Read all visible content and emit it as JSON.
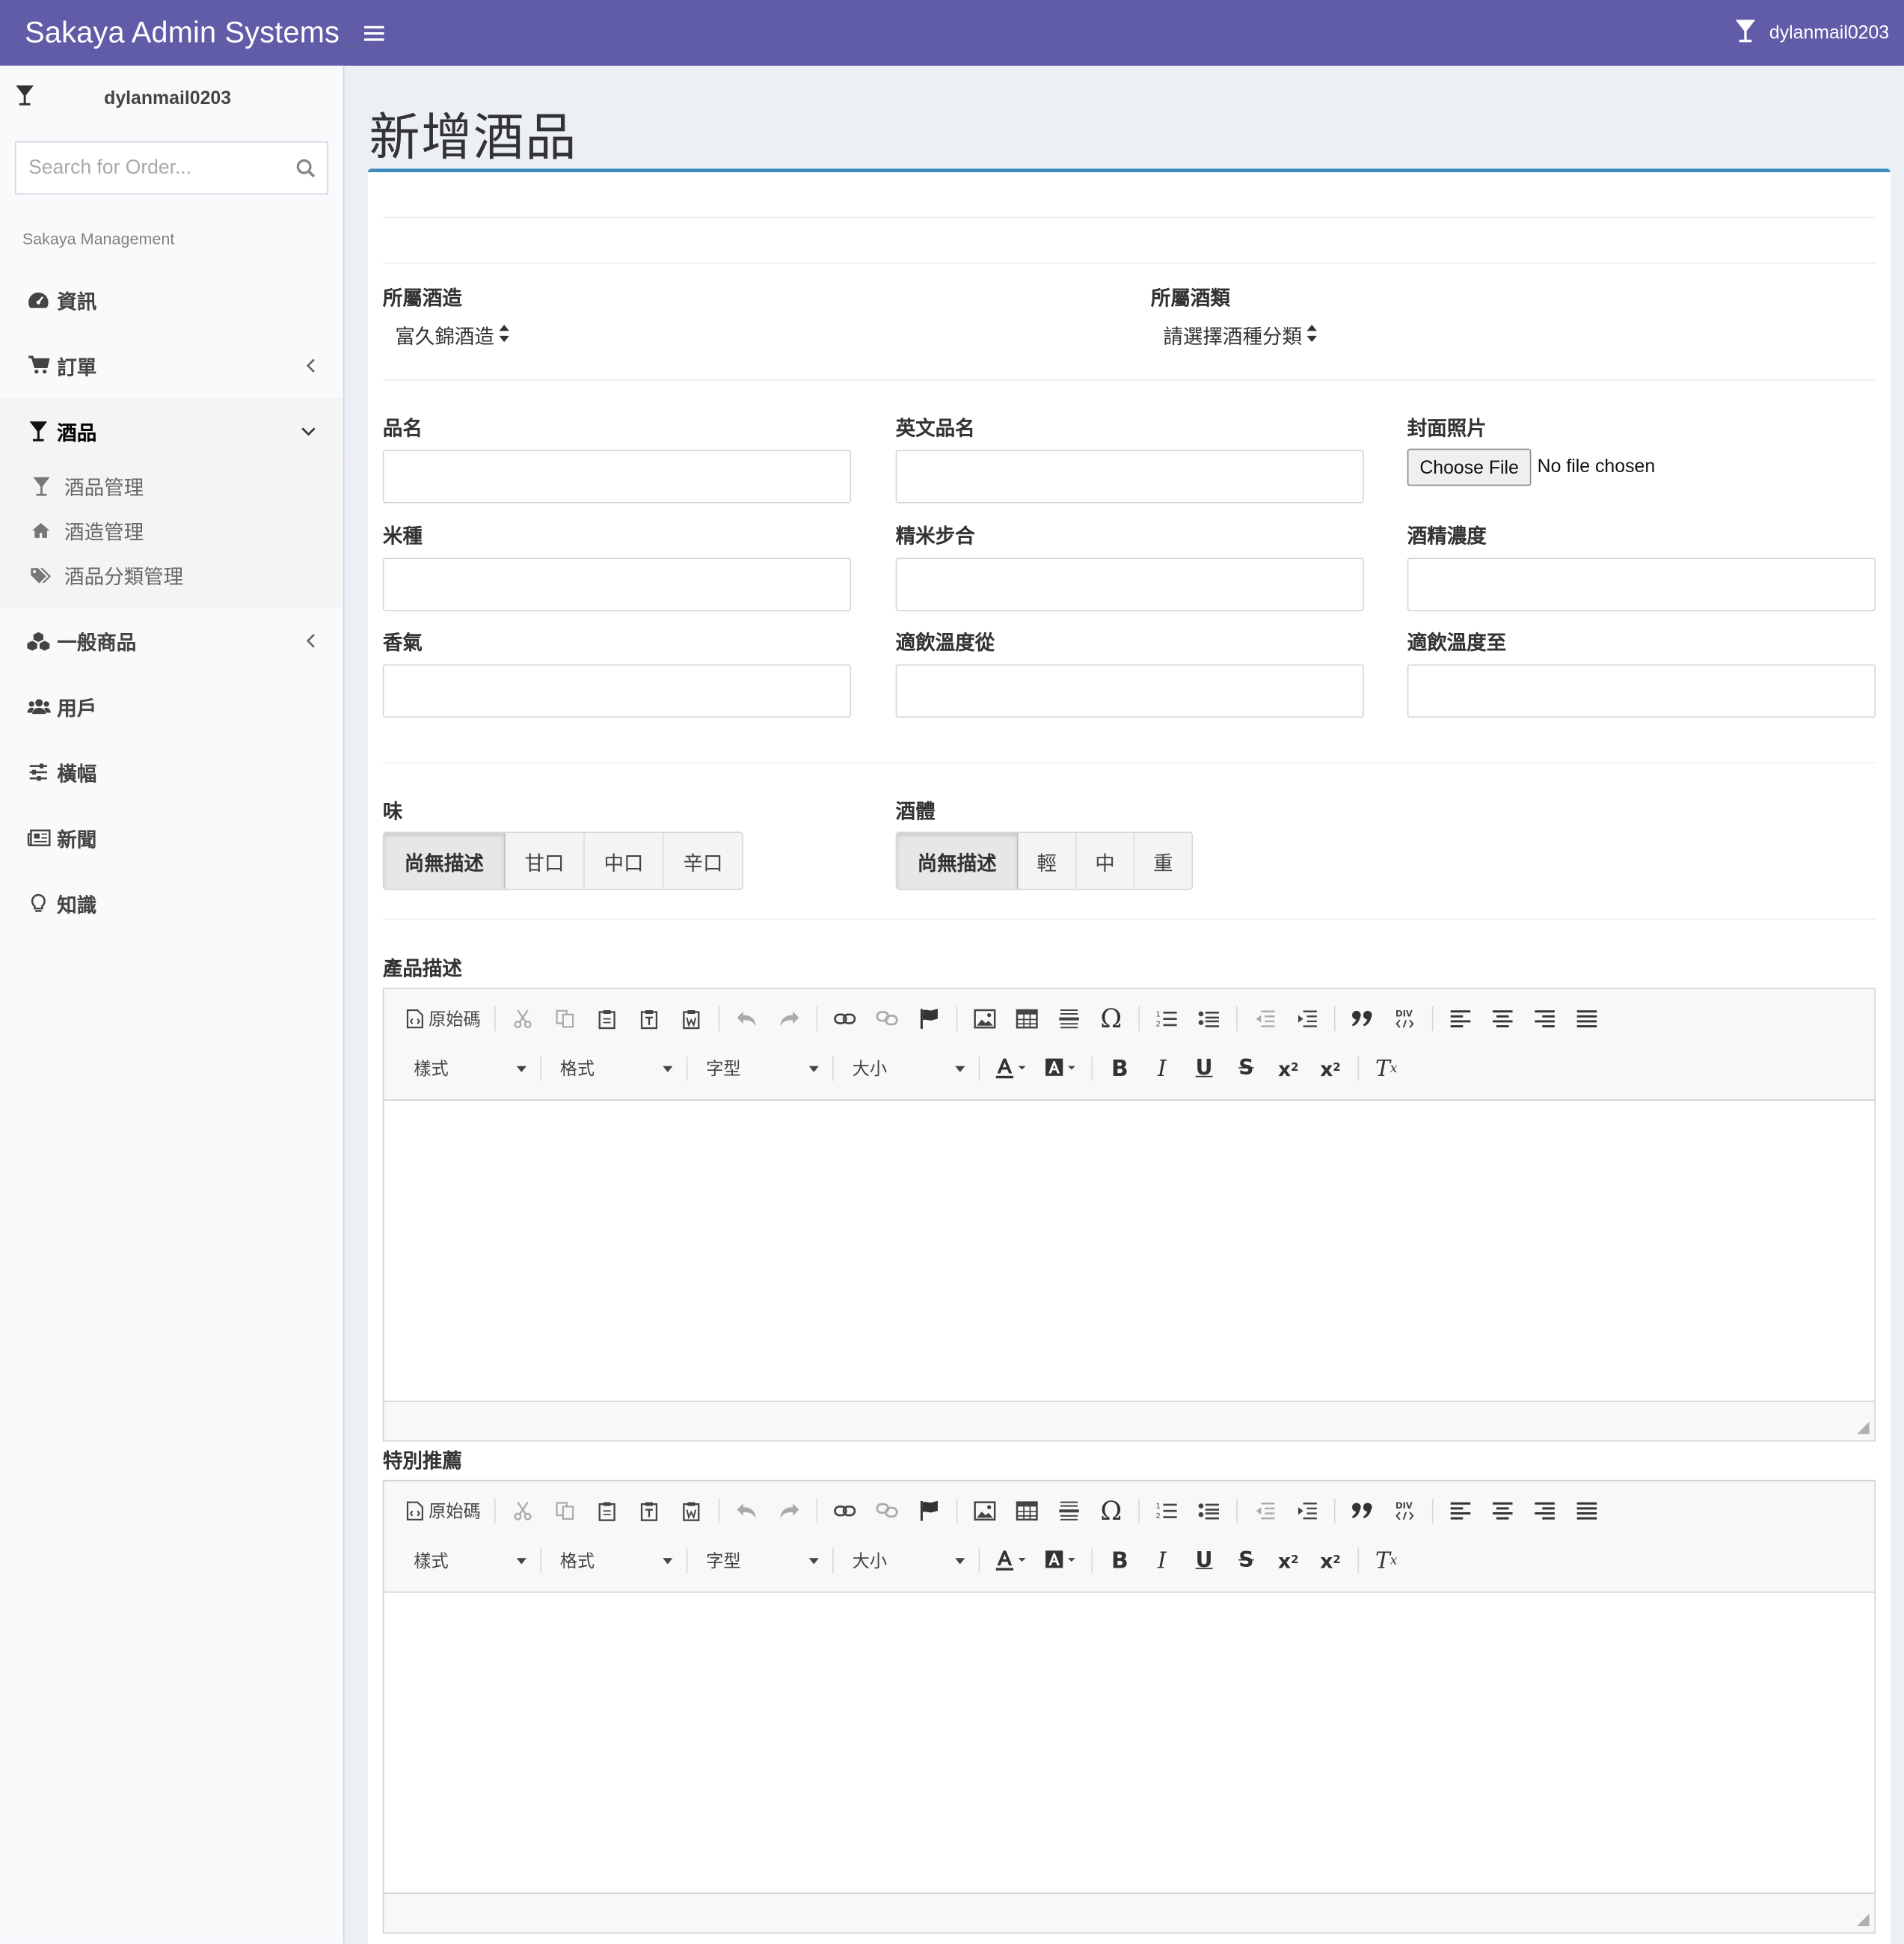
{
  "app": {
    "brand": "Sakaya Admin Systems",
    "username": "dylanmail0203"
  },
  "sidebar": {
    "username": "dylanmail0203",
    "search_placeholder": "Search for Order...",
    "section_header": "Sakaya Management",
    "items": [
      {
        "label": "資訊",
        "icon": "dashboard-icon"
      },
      {
        "label": "訂單",
        "icon": "cart-icon"
      },
      {
        "label": "酒品",
        "icon": "glass-icon"
      },
      {
        "label": "一般商品",
        "icon": "cubes-icon"
      },
      {
        "label": "用戶",
        "icon": "users-icon"
      },
      {
        "label": "橫幅",
        "icon": "sliders-icon"
      },
      {
        "label": "新聞",
        "icon": "newspaper-icon"
      },
      {
        "label": "知識",
        "icon": "lightbulb-icon"
      }
    ],
    "subitems": [
      {
        "label": "酒品管理",
        "icon": "glass-icon"
      },
      {
        "label": "酒造管理",
        "icon": "home-icon"
      },
      {
        "label": "酒品分類管理",
        "icon": "tags-icon"
      }
    ]
  },
  "page": {
    "title": "新增酒品"
  },
  "form": {
    "brewery_label": "所屬酒造",
    "brewery_value": "富久錦酒造",
    "category_label": "所屬酒類",
    "category_value": "請選擇酒種分類",
    "name_label": "品名",
    "en_name_label": "英文品名",
    "cover_label": "封面照片",
    "choose_file": "Choose File",
    "no_file": "No file chosen",
    "rice_label": "米種",
    "polish_label": "精米步合",
    "alcohol_label": "酒精濃度",
    "aroma_label": "香氣",
    "temp_from_label": "適飲溫度從",
    "temp_to_label": "適飲溫度至",
    "taste_label": "味",
    "taste_options": [
      "尚無描述",
      "甘口",
      "中口",
      "辛口"
    ],
    "body_label": "酒體",
    "body_options": [
      "尚無描述",
      "輕",
      "中",
      "重"
    ],
    "desc_label": "產品描述",
    "recommend_label": "特別推薦"
  },
  "editor": {
    "source_label": "原始碼",
    "combos": [
      "樣式",
      "格式",
      "字型",
      "大小"
    ]
  },
  "colors": {
    "header_bg": "#605ca8",
    "box_top_border": "#3c8dbc",
    "content_bg": "#ecf0f5"
  }
}
